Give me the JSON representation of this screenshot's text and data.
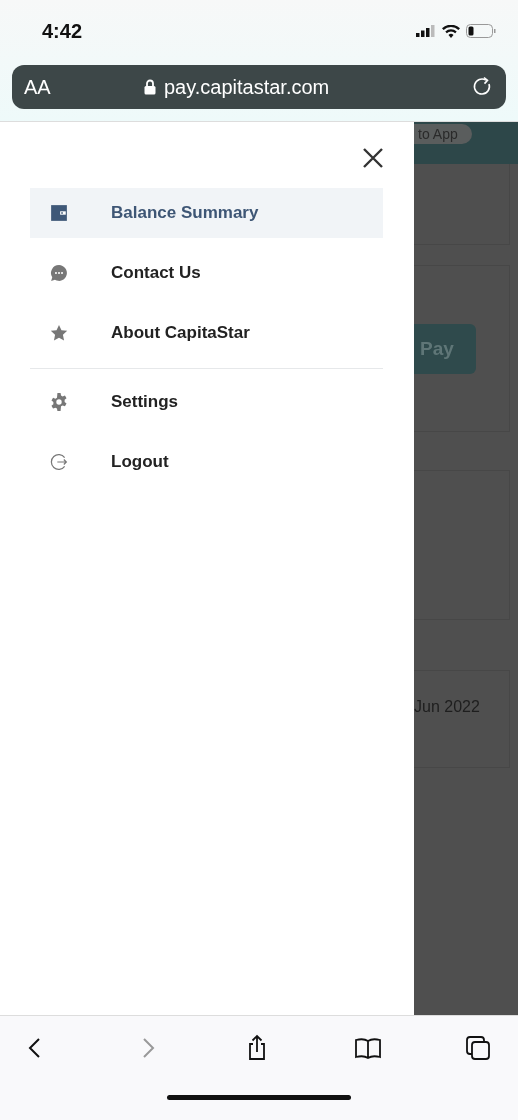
{
  "status_bar": {
    "time": "4:42"
  },
  "address_bar": {
    "text_size_label": "AA",
    "url": "pay.capitastar.com"
  },
  "menu": {
    "groups": [
      [
        {
          "kind": "balance",
          "label": "Balance Summary",
          "selected": true
        },
        {
          "kind": "contact",
          "label": "Contact Us",
          "selected": false
        },
        {
          "kind": "about",
          "label": "About CapitaStar",
          "selected": false
        }
      ],
      [
        {
          "kind": "settings",
          "label": "Settings",
          "selected": false
        },
        {
          "kind": "logout",
          "label": "Logout",
          "selected": false
        }
      ]
    ]
  },
  "background_page": {
    "app_button": "to App",
    "pay_button": "Pay",
    "date": "Jun 2022"
  },
  "toolbar": [
    {
      "kind": "back",
      "disabled": false
    },
    {
      "kind": "forward",
      "disabled": true
    },
    {
      "kind": "share",
      "disabled": false
    },
    {
      "kind": "bookmarks",
      "disabled": false
    },
    {
      "kind": "tabs",
      "disabled": false
    }
  ]
}
